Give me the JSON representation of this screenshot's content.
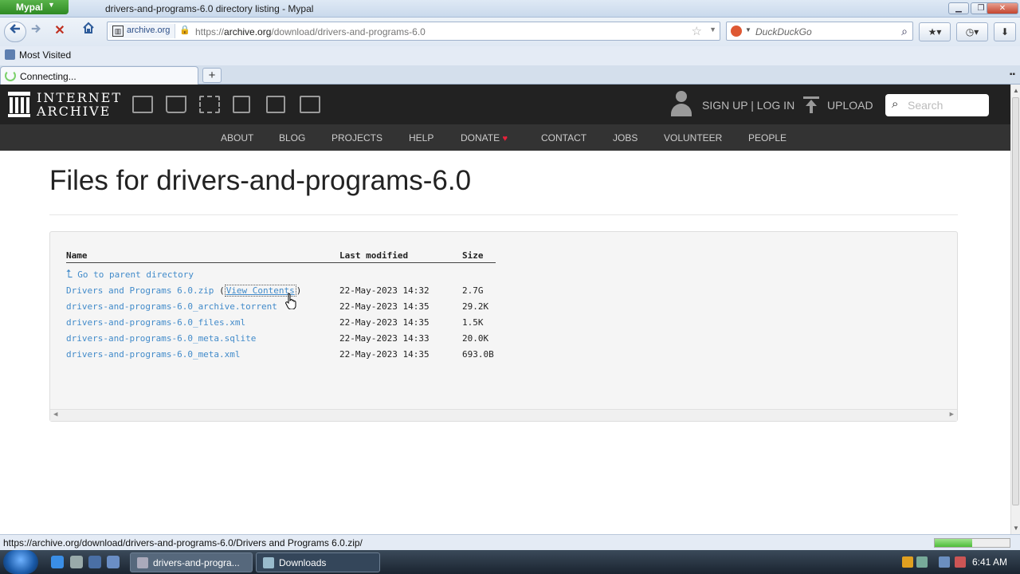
{
  "window": {
    "app_name": "Mypal",
    "title": "drivers-and-programs-6.0 directory listing - Mypal",
    "controls": {
      "minimize": "▁",
      "restore": "❐",
      "close": "✕"
    }
  },
  "navbar": {
    "site_identity": "archive.org",
    "url_scheme": "https://",
    "url_host": "archive.org",
    "url_path": "/download/drivers-and-programs-6.0",
    "search_placeholder": "DuckDuckGo"
  },
  "bookmarks": {
    "most_visited": "Most Visited"
  },
  "tabs": [
    {
      "label": "Connecting..."
    }
  ],
  "new_tab": "+",
  "ia": {
    "logo_line1": "INTERNET",
    "logo_line2": "ARCHIVE",
    "signup": "SIGN UP | LOG IN",
    "upload": "UPLOAD",
    "search_placeholder": "Search",
    "nav": [
      "ABOUT",
      "BLOG",
      "PROJECTS",
      "HELP",
      "DONATE",
      "CONTACT",
      "JOBS",
      "VOLUNTEER",
      "PEOPLE"
    ],
    "donate_heart": "♥"
  },
  "page": {
    "title": "Files for drivers-and-programs-6.0",
    "columns": {
      "name": "Name",
      "modified": "Last modified",
      "size": "Size"
    },
    "parent_link": "Go to parent directory",
    "files": [
      {
        "name": "Drivers and Programs 6.0.zip",
        "view_contents": "View Contents",
        "modified": "22-May-2023 14:32",
        "size": "2.7G"
      },
      {
        "name": "drivers-and-programs-6.0_archive.torrent",
        "modified": "22-May-2023 14:35",
        "size": "29.2K"
      },
      {
        "name": "drivers-and-programs-6.0_files.xml",
        "modified": "22-May-2023 14:35",
        "size": "1.5K"
      },
      {
        "name": "drivers-and-programs-6.0_meta.sqlite",
        "modified": "22-May-2023 14:33",
        "size": "20.0K"
      },
      {
        "name": "drivers-and-programs-6.0_meta.xml",
        "modified": "22-May-2023 14:35",
        "size": "693.0B"
      }
    ]
  },
  "status": {
    "text": "https://archive.org/download/drivers-and-programs-6.0/Drivers and Programs 6.0.zip/",
    "progress": 0.5
  },
  "taskbar": {
    "tasks": [
      {
        "label": "drivers-and-progra..."
      },
      {
        "label": "Downloads"
      }
    ],
    "clock": "6:41 AM"
  },
  "colors": {
    "ia_header": "#222222",
    "ia_nav": "#333333",
    "link": "#428bca",
    "donate_heart": "#e8213a"
  }
}
